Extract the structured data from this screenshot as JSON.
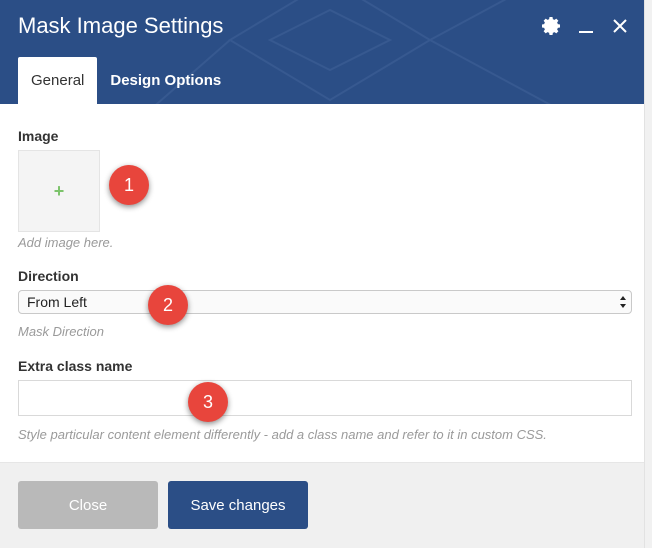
{
  "dialog": {
    "title": "Mask Image Settings",
    "header_color": "#2b4e86",
    "icons": [
      "gear-icon",
      "minimize-icon",
      "close-icon"
    ]
  },
  "tabs": [
    {
      "label": "General",
      "active": true
    },
    {
      "label": "Design Options",
      "active": false
    }
  ],
  "fields": {
    "image": {
      "label": "Image",
      "button_icon": "plus-icon",
      "help": "Add image here."
    },
    "direction": {
      "label": "Direction",
      "value": "From Left",
      "help": "Mask Direction"
    },
    "extra_class": {
      "label": "Extra class name",
      "value": "",
      "help": "Style particular content element differently - add a class name and refer to it in custom CSS."
    }
  },
  "annotations": [
    "1",
    "2",
    "3"
  ],
  "annotation_color": "#e8453c",
  "footer": {
    "close_label": "Close",
    "save_label": "Save changes"
  }
}
